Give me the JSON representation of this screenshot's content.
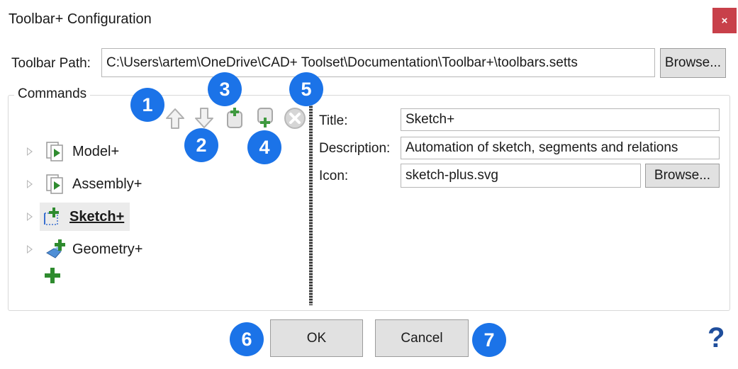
{
  "window": {
    "title": "Toolbar+ Configuration",
    "close_label": "×"
  },
  "toolbar_path": {
    "label": "Toolbar Path:",
    "value": "C:\\Users\\artem\\OneDrive\\CAD+ Toolset\\Documentation\\Toolbar+\\toolbars.setts",
    "browse_label": "Browse..."
  },
  "commands": {
    "group_label": "Commands",
    "toolbar_icons": [
      "arrow-up-icon",
      "arrow-down-icon",
      "add-command-icon",
      "add-group-icon",
      "remove-icon"
    ],
    "tree": [
      {
        "label": "Model+",
        "icon": "model-plus-icon",
        "selected": false
      },
      {
        "label": "Assembly+",
        "icon": "assembly-plus-icon",
        "selected": false
      },
      {
        "label": "Sketch+",
        "icon": "sketch-plus-icon",
        "selected": true
      },
      {
        "label": "Geometry+",
        "icon": "geometry-plus-icon",
        "selected": false
      }
    ],
    "add_icon": "add-toolbar-icon"
  },
  "properties": {
    "title_label": "Title:",
    "title_value": "Sketch+",
    "description_label": "Description:",
    "description_value": "Automation of sketch, segments and relations",
    "icon_label": "Icon:",
    "icon_value": "sketch-plus.svg",
    "icon_browse_label": "Browse..."
  },
  "footer": {
    "ok_label": "OK",
    "cancel_label": "Cancel",
    "help_label": "?"
  },
  "callouts": [
    "1",
    "2",
    "3",
    "4",
    "5",
    "6",
    "7"
  ],
  "colors": {
    "callout": "#1b73e8",
    "close": "#c8404a",
    "green_plus": "#2e8b2e"
  }
}
